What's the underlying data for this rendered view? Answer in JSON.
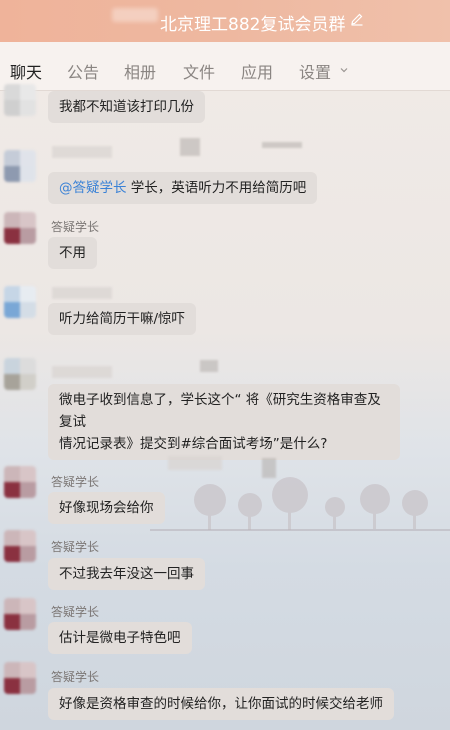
{
  "window": {
    "title": "北京理工882复试会员群"
  },
  "tabs": [
    {
      "label": "聊天"
    },
    {
      "label": "公告"
    },
    {
      "label": "相册"
    },
    {
      "label": "文件"
    },
    {
      "label": "应用"
    },
    {
      "label": "设置"
    }
  ],
  "messages": [
    {
      "sender": "",
      "text": "我都不知道该打印几份"
    },
    {
      "sender": "",
      "mention": "@答疑学长",
      "text": " 学长，英语听力不用给简历吧"
    },
    {
      "sender": "答疑学长",
      "text": "不用"
    },
    {
      "sender": "",
      "text": "听力给简历干嘛/惊吓"
    },
    {
      "sender": "",
      "line1": "微电子收到信息了，学长这个“ 将《研究生资格审查及复试",
      "line2": "情况记录表》提交到#综合面试考场”是什么?"
    },
    {
      "sender": "答疑学长",
      "text": "好像现场会给你"
    },
    {
      "sender": "答疑学长",
      "text": "不过我去年没这一回事"
    },
    {
      "sender": "答疑学长",
      "text": "估计是微电子特色吧"
    },
    {
      "sender": "答疑学长",
      "text": "好像是资格审查的时候给你，让你面试的时候交给老师"
    }
  ],
  "colors": {
    "titlebar": "#efb39a",
    "bubble": "#e2ddda",
    "mention": "#3b82d6"
  }
}
